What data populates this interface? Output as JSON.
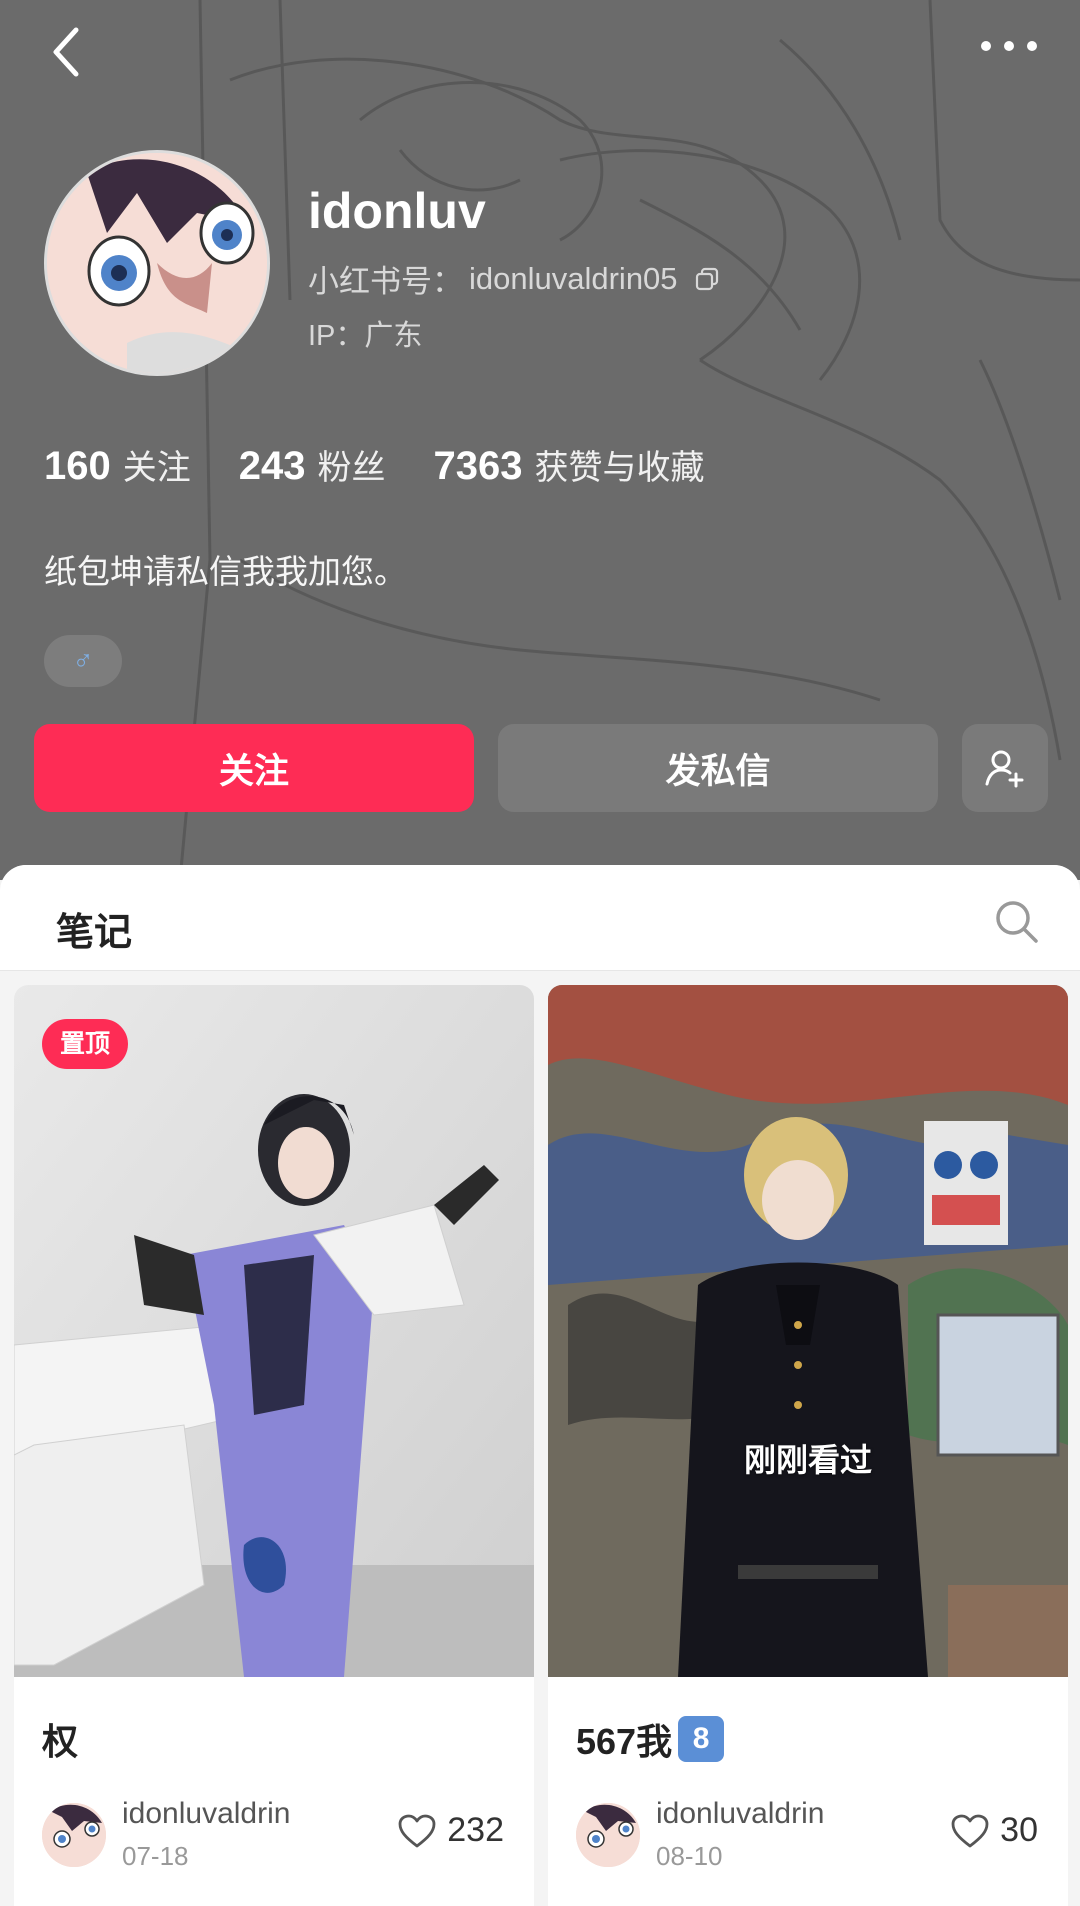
{
  "profile": {
    "username": "idonluv",
    "xhs_id_label": "小红书号：",
    "xhs_id": "idonluvaldrin05",
    "ip_label": "IP：",
    "ip_location": "广东",
    "bio": "纸包坤请私信我我加您。",
    "gender": "♂"
  },
  "stats": [
    {
      "value": "160",
      "label": "关注"
    },
    {
      "value": "243",
      "label": "粉丝"
    },
    {
      "value": "7363",
      "label": "获赞与收藏"
    }
  ],
  "actions": {
    "follow_label": "关注",
    "message_label": "发私信"
  },
  "tabs": {
    "notes_label": "笔记"
  },
  "notes": [
    {
      "title": "权",
      "pin_badge": "置顶",
      "author": "idonluvaldrin",
      "date": "07-18",
      "likes": "232"
    },
    {
      "title": "567我",
      "title_badge": "8",
      "viewed_label": "刚刚看过",
      "author": "idonluvaldrin",
      "date": "08-10",
      "likes": "30"
    }
  ],
  "colors": {
    "accent": "#fe2c55",
    "header_bg": "#6b6b6b",
    "secondary_button": "#7a7a7a"
  },
  "icons": [
    "back-arrow-icon",
    "more-icon",
    "copy-icon",
    "male-icon",
    "add-friend-icon",
    "search-icon",
    "heart-icon"
  ]
}
